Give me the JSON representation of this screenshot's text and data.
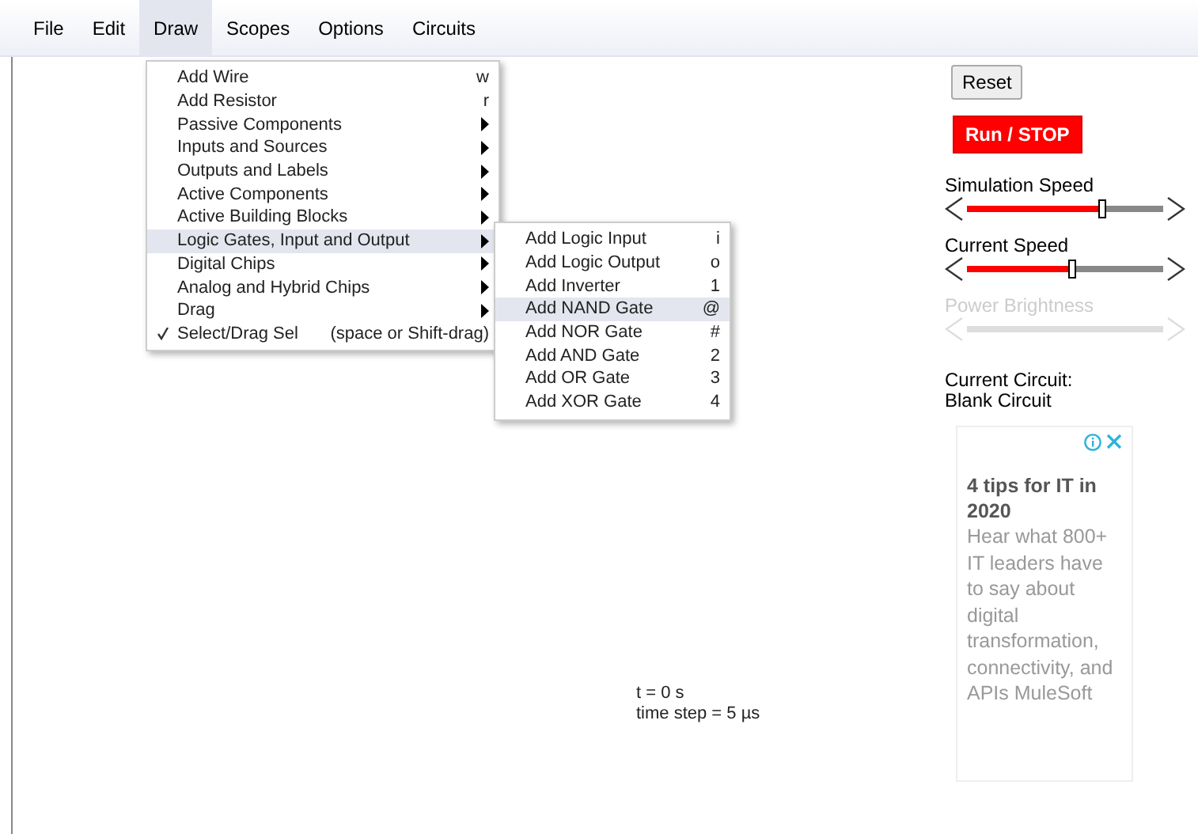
{
  "menubar": [
    {
      "label": "File",
      "selected": false
    },
    {
      "label": "Edit",
      "selected": false
    },
    {
      "label": "Draw",
      "selected": true
    },
    {
      "label": "Scopes",
      "selected": false
    },
    {
      "label": "Options",
      "selected": false
    },
    {
      "label": "Circuits",
      "selected": false
    }
  ],
  "draw_menu": [
    {
      "label": "Add Wire",
      "shortcut": "w",
      "submenu": false,
      "checked": false,
      "selected": false
    },
    {
      "label": "Add Resistor",
      "shortcut": "r",
      "submenu": false,
      "checked": false,
      "selected": false
    },
    {
      "label": "Passive Components",
      "submenu": true,
      "checked": false,
      "selected": false
    },
    {
      "label": "Inputs and Sources",
      "submenu": true,
      "checked": false,
      "selected": false
    },
    {
      "label": "Outputs and Labels",
      "submenu": true,
      "checked": false,
      "selected": false
    },
    {
      "label": "Active Components",
      "submenu": true,
      "checked": false,
      "selected": false
    },
    {
      "label": "Active Building Blocks",
      "submenu": true,
      "checked": false,
      "selected": false
    },
    {
      "label": "Logic Gates, Input and Output",
      "submenu": true,
      "checked": false,
      "selected": true
    },
    {
      "label": "Digital Chips",
      "submenu": true,
      "checked": false,
      "selected": false
    },
    {
      "label": "Analog and Hybrid Chips",
      "submenu": true,
      "checked": false,
      "selected": false
    },
    {
      "label": "Drag",
      "submenu": true,
      "checked": false,
      "selected": false
    },
    {
      "label": "Select/Drag Sel",
      "shortcut": "(space or Shift-drag)",
      "submenu": false,
      "checked": true,
      "selected": false
    }
  ],
  "logic_submenu": [
    {
      "label": "Add Logic Input",
      "shortcut": "i",
      "selected": false
    },
    {
      "label": "Add Logic Output",
      "shortcut": "o",
      "selected": false
    },
    {
      "label": "Add Inverter",
      "shortcut": "1",
      "selected": false
    },
    {
      "label": "Add NAND Gate",
      "shortcut": "@",
      "selected": true
    },
    {
      "label": "Add NOR Gate",
      "shortcut": "#",
      "selected": false
    },
    {
      "label": "Add AND Gate",
      "shortcut": "2",
      "selected": false
    },
    {
      "label": "Add OR Gate",
      "shortcut": "3",
      "selected": false
    },
    {
      "label": "Add XOR Gate",
      "shortcut": "4",
      "selected": false
    }
  ],
  "canvas_info": [
    "t = 0 s",
    "time step = 5 µs"
  ],
  "reset_button": "Reset",
  "run_button": "Run / STOP",
  "sliders": [
    {
      "label": "Simulation Speed",
      "level": 0.69,
      "disabled": false
    },
    {
      "label": "Current Speed",
      "level": 0.54,
      "disabled": false
    },
    {
      "label": "Power Brightness",
      "disabled": true
    }
  ],
  "current_circuit": [
    "Current Circuit:",
    "Blank Circuit"
  ],
  "ad": {
    "title": "4 tips for IT in 2020",
    "body": "Hear what 800+ IT leaders have to say about digital transformation, connectivity, and APIs MuleSoft"
  }
}
